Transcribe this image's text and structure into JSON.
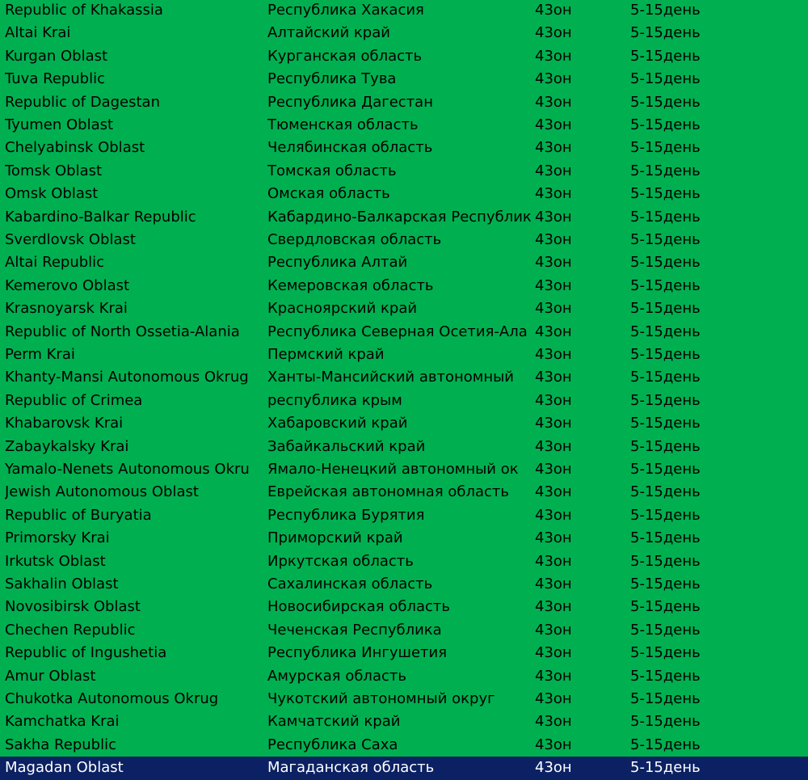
{
  "colors": {
    "background": "#00b050",
    "selected_row_background": "#0b2163",
    "selected_row_text": "#ffffff",
    "text": "#000000"
  },
  "rows": [
    {
      "en": "Republic of Khakassia",
      "ru": "Республика Хакасия",
      "courier": "43он",
      "days": "5-15день"
    },
    {
      "en": "Altai Krai",
      "ru": "Алтайский край",
      "courier": "43он",
      "days": "5-15день"
    },
    {
      "en": "Kurgan Oblast",
      "ru": "Курганская область",
      "courier": "43он",
      "days": "5-15день"
    },
    {
      "en": "Tuva Republic",
      "ru": "Республика Тува",
      "courier": "43он",
      "days": "5-15день"
    },
    {
      "en": "Republic of Dagestan",
      "ru": "Республика Дагестан",
      "courier": "43он",
      "days": "5-15день"
    },
    {
      "en": "Tyumen Oblast",
      "ru": "Тюменская область",
      "courier": "43он",
      "days": "5-15день"
    },
    {
      "en": "Chelyabinsk Oblast",
      "ru": "Челябинская область",
      "courier": "43он",
      "days": "5-15день"
    },
    {
      "en": "Tomsk Oblast",
      "ru": "Томская область",
      "courier": "43он",
      "days": "5-15день"
    },
    {
      "en": "Omsk Oblast",
      "ru": "Омская область",
      "courier": "43он",
      "days": "5-15день"
    },
    {
      "en": "Kabardino-Balkar Republic",
      "ru": "Кабардино-Балкарская Республик",
      "courier": "43он",
      "days": "5-15день"
    },
    {
      "en": "Sverdlovsk Oblast",
      "ru": "Свердловская область",
      "courier": "43он",
      "days": "5-15день"
    },
    {
      "en": "Altai Republic",
      "ru": "Республика Алтай",
      "courier": "43он",
      "days": "5-15день"
    },
    {
      "en": "Kemerovo Oblast",
      "ru": "Кемеровская область",
      "courier": "43он",
      "days": "5-15день"
    },
    {
      "en": "Krasnoyarsk Krai",
      "ru": "Красноярский край",
      "courier": "43он",
      "days": "5-15день"
    },
    {
      "en": "Republic of North Ossetia-Alania",
      "ru": "Республика Северная Осетия-Ала",
      "courier": "43он",
      "days": "5-15день"
    },
    {
      "en": "Perm Krai",
      "ru": "Пермский край",
      "courier": "43он",
      "days": "5-15день"
    },
    {
      "en": "Khanty-Mansi Autonomous Okrug",
      "ru": "Ханты-Мансийский автономный",
      "courier": "43он",
      "days": "5-15день"
    },
    {
      "en": "Republic of Crimea",
      "ru": "республика крым",
      "courier": "43он",
      "days": "5-15день"
    },
    {
      "en": "Khabarovsk Krai",
      "ru": "Хабаровский край",
      "courier": "43он",
      "days": "5-15день"
    },
    {
      "en": "Zabaykalsky Krai",
      "ru": "Забайкальский край",
      "courier": "43он",
      "days": "5-15день"
    },
    {
      "en": "Yamalo-Nenets Autonomous Okru",
      "ru": "Ямало-Ненецкий автономный ок",
      "courier": "43он",
      "days": "5-15день"
    },
    {
      "en": "Jewish Autonomous Oblast",
      "ru": "Еврейская автономная область",
      "courier": "43он",
      "days": "5-15день"
    },
    {
      "en": "Republic of Buryatia",
      "ru": "Республика Бурятия",
      "courier": "43он",
      "days": "5-15день"
    },
    {
      "en": "Primorsky Krai",
      "ru": "Приморский край",
      "courier": "43он",
      "days": "5-15день"
    },
    {
      "en": "Irkutsk Oblast",
      "ru": "Иркутская область",
      "courier": "43он",
      "days": "5-15день"
    },
    {
      "en": "Sakhalin Oblast",
      "ru": "Сахалинская область",
      "courier": "43он",
      "days": "5-15день"
    },
    {
      "en": "Novosibirsk Oblast",
      "ru": "Новосибирская область",
      "courier": "43он",
      "days": "5-15день"
    },
    {
      "en": "Chechen Republic",
      "ru": "Чеченская Республика",
      "courier": "43он",
      "days": "5-15день"
    },
    {
      "en": "Republic of Ingushetia",
      "ru": "Республика Ингушетия",
      "courier": "43он",
      "days": "5-15день"
    },
    {
      "en": "Amur Oblast",
      "ru": "Амурская область",
      "courier": "43он",
      "days": "5-15день"
    },
    {
      "en": "Chukotka  Autonomous Okrug",
      "ru": "Чукотский автономный округ",
      "courier": "43он",
      "days": "5-15день"
    },
    {
      "en": "Kamchatka Krai",
      "ru": "Камчатский край",
      "courier": "43он",
      "days": "5-15день"
    },
    {
      "en": "Sakha Republic",
      "ru": "Республика Саха",
      "courier": "43он",
      "days": "5-15день"
    },
    {
      "en": "Magadan Oblast",
      "ru": "Магаданская область",
      "courier": "43он",
      "days": "5-15день",
      "selected": true
    }
  ]
}
